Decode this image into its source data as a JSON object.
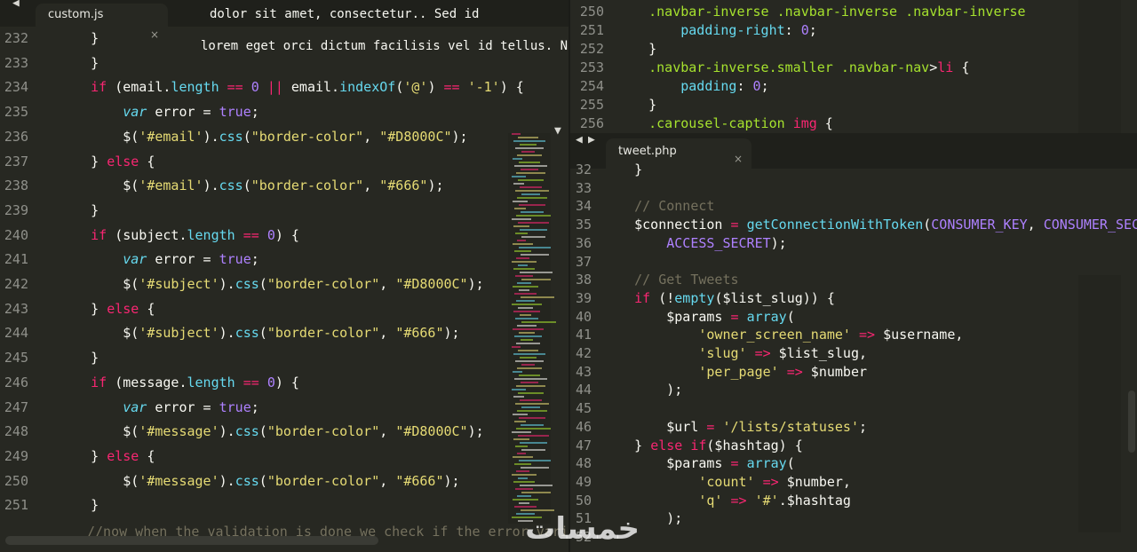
{
  "left_pane": {
    "tab_label": "custom.js",
    "close_label": "×",
    "top_text_1": "dolor sit amet, consectetur.. Sed id",
    "top_text_2": "lorem eget orci dictum facilisis vel id tellus. Nullam",
    "lines": [
      {
        "n": "232",
        "html": "    }"
      },
      {
        "n": "233",
        "html": "    }"
      },
      {
        "n": "234",
        "html": "    if (email.length == 0 || email.indexOf('@') == '-1') {"
      },
      {
        "n": "235",
        "html": "        var error = true;"
      },
      {
        "n": "236",
        "html": "        $('#email').css(\"border-color\", \"#D8000C\");"
      },
      {
        "n": "237",
        "html": "    } else {"
      },
      {
        "n": "238",
        "html": "        $('#email').css(\"border-color\", \"#666\");"
      },
      {
        "n": "239",
        "html": "    }"
      },
      {
        "n": "240",
        "html": "    if (subject.length == 0) {"
      },
      {
        "n": "241",
        "html": "        var error = true;"
      },
      {
        "n": "242",
        "html": "        $('#subject').css(\"border-color\", \"#D8000C\");"
      },
      {
        "n": "243",
        "html": "    } else {"
      },
      {
        "n": "244",
        "html": "        $('#subject').css(\"border-color\", \"#666\");"
      },
      {
        "n": "245",
        "html": "    }"
      },
      {
        "n": "246",
        "html": "    if (message.length == 0) {"
      },
      {
        "n": "247",
        "html": "        var error = true;"
      },
      {
        "n": "248",
        "html": "        $('#message').css(\"border-color\", \"#D8000C\");"
      },
      {
        "n": "249",
        "html": "    } else {"
      },
      {
        "n": "250",
        "html": "        $('#message').css(\"border-color\", \"#666\");"
      },
      {
        "n": "251",
        "html": "    }"
      }
    ],
    "bottom_text": "//now when the validation is done we check if the error variable is false ("
  },
  "right_top_pane": {
    "lines": [
      {
        "n": "250",
        "text": "    .navbar-inverse .navbar-inverse .navbar-inverse"
      },
      {
        "n": "251",
        "text": "        padding-right: 0;"
      },
      {
        "n": "252",
        "text": "    }"
      },
      {
        "n": "253",
        "text": "    .navbar-inverse.smaller .navbar-nav>li {"
      },
      {
        "n": "254",
        "text": "        padding: 0;"
      },
      {
        "n": "255",
        "text": "    }"
      },
      {
        "n": "256",
        "text": "    .carousel-caption img {"
      }
    ]
  },
  "right_bottom_pane": {
    "tab_label": "tweet.php",
    "close_label": "×",
    "lines": [
      {
        "n": "32",
        "text": "    }"
      },
      {
        "n": "33",
        "text": ""
      },
      {
        "n": "34",
        "text": "    // Connect"
      },
      {
        "n": "35",
        "text": "    $connection = getConnectionWithToken(CONSUMER_KEY, CONSUMER_SECRET, ACCESS_TOKEN,"
      },
      {
        "n": "36",
        "text": "        ACCESS_SECRET);"
      },
      {
        "n": "37",
        "text": ""
      },
      {
        "n": "38",
        "text": "    // Get Tweets"
      },
      {
        "n": "39",
        "text": "    if (!empty($list_slug)) {"
      },
      {
        "n": "40",
        "text": "        $params = array("
      },
      {
        "n": "41",
        "text": "            'owner_screen_name' => $username,"
      },
      {
        "n": "42",
        "text": "            'slug' => $list_slug,"
      },
      {
        "n": "43",
        "text": "            'per_page' => $number"
      },
      {
        "n": "44",
        "text": "        );"
      },
      {
        "n": "45",
        "text": ""
      },
      {
        "n": "46",
        "text": "        $url = '/lists/statuses';"
      },
      {
        "n": "47",
        "text": "    } else if($hashtag) {"
      },
      {
        "n": "48",
        "text": "        $params = array("
      },
      {
        "n": "49",
        "text": "            'count' => $number,"
      },
      {
        "n": "50",
        "text": "            'q' => '#'.$hashtag"
      },
      {
        "n": "51",
        "text": "        );"
      },
      {
        "n": "52",
        "text": ""
      }
    ]
  },
  "watermark": "خمسات"
}
